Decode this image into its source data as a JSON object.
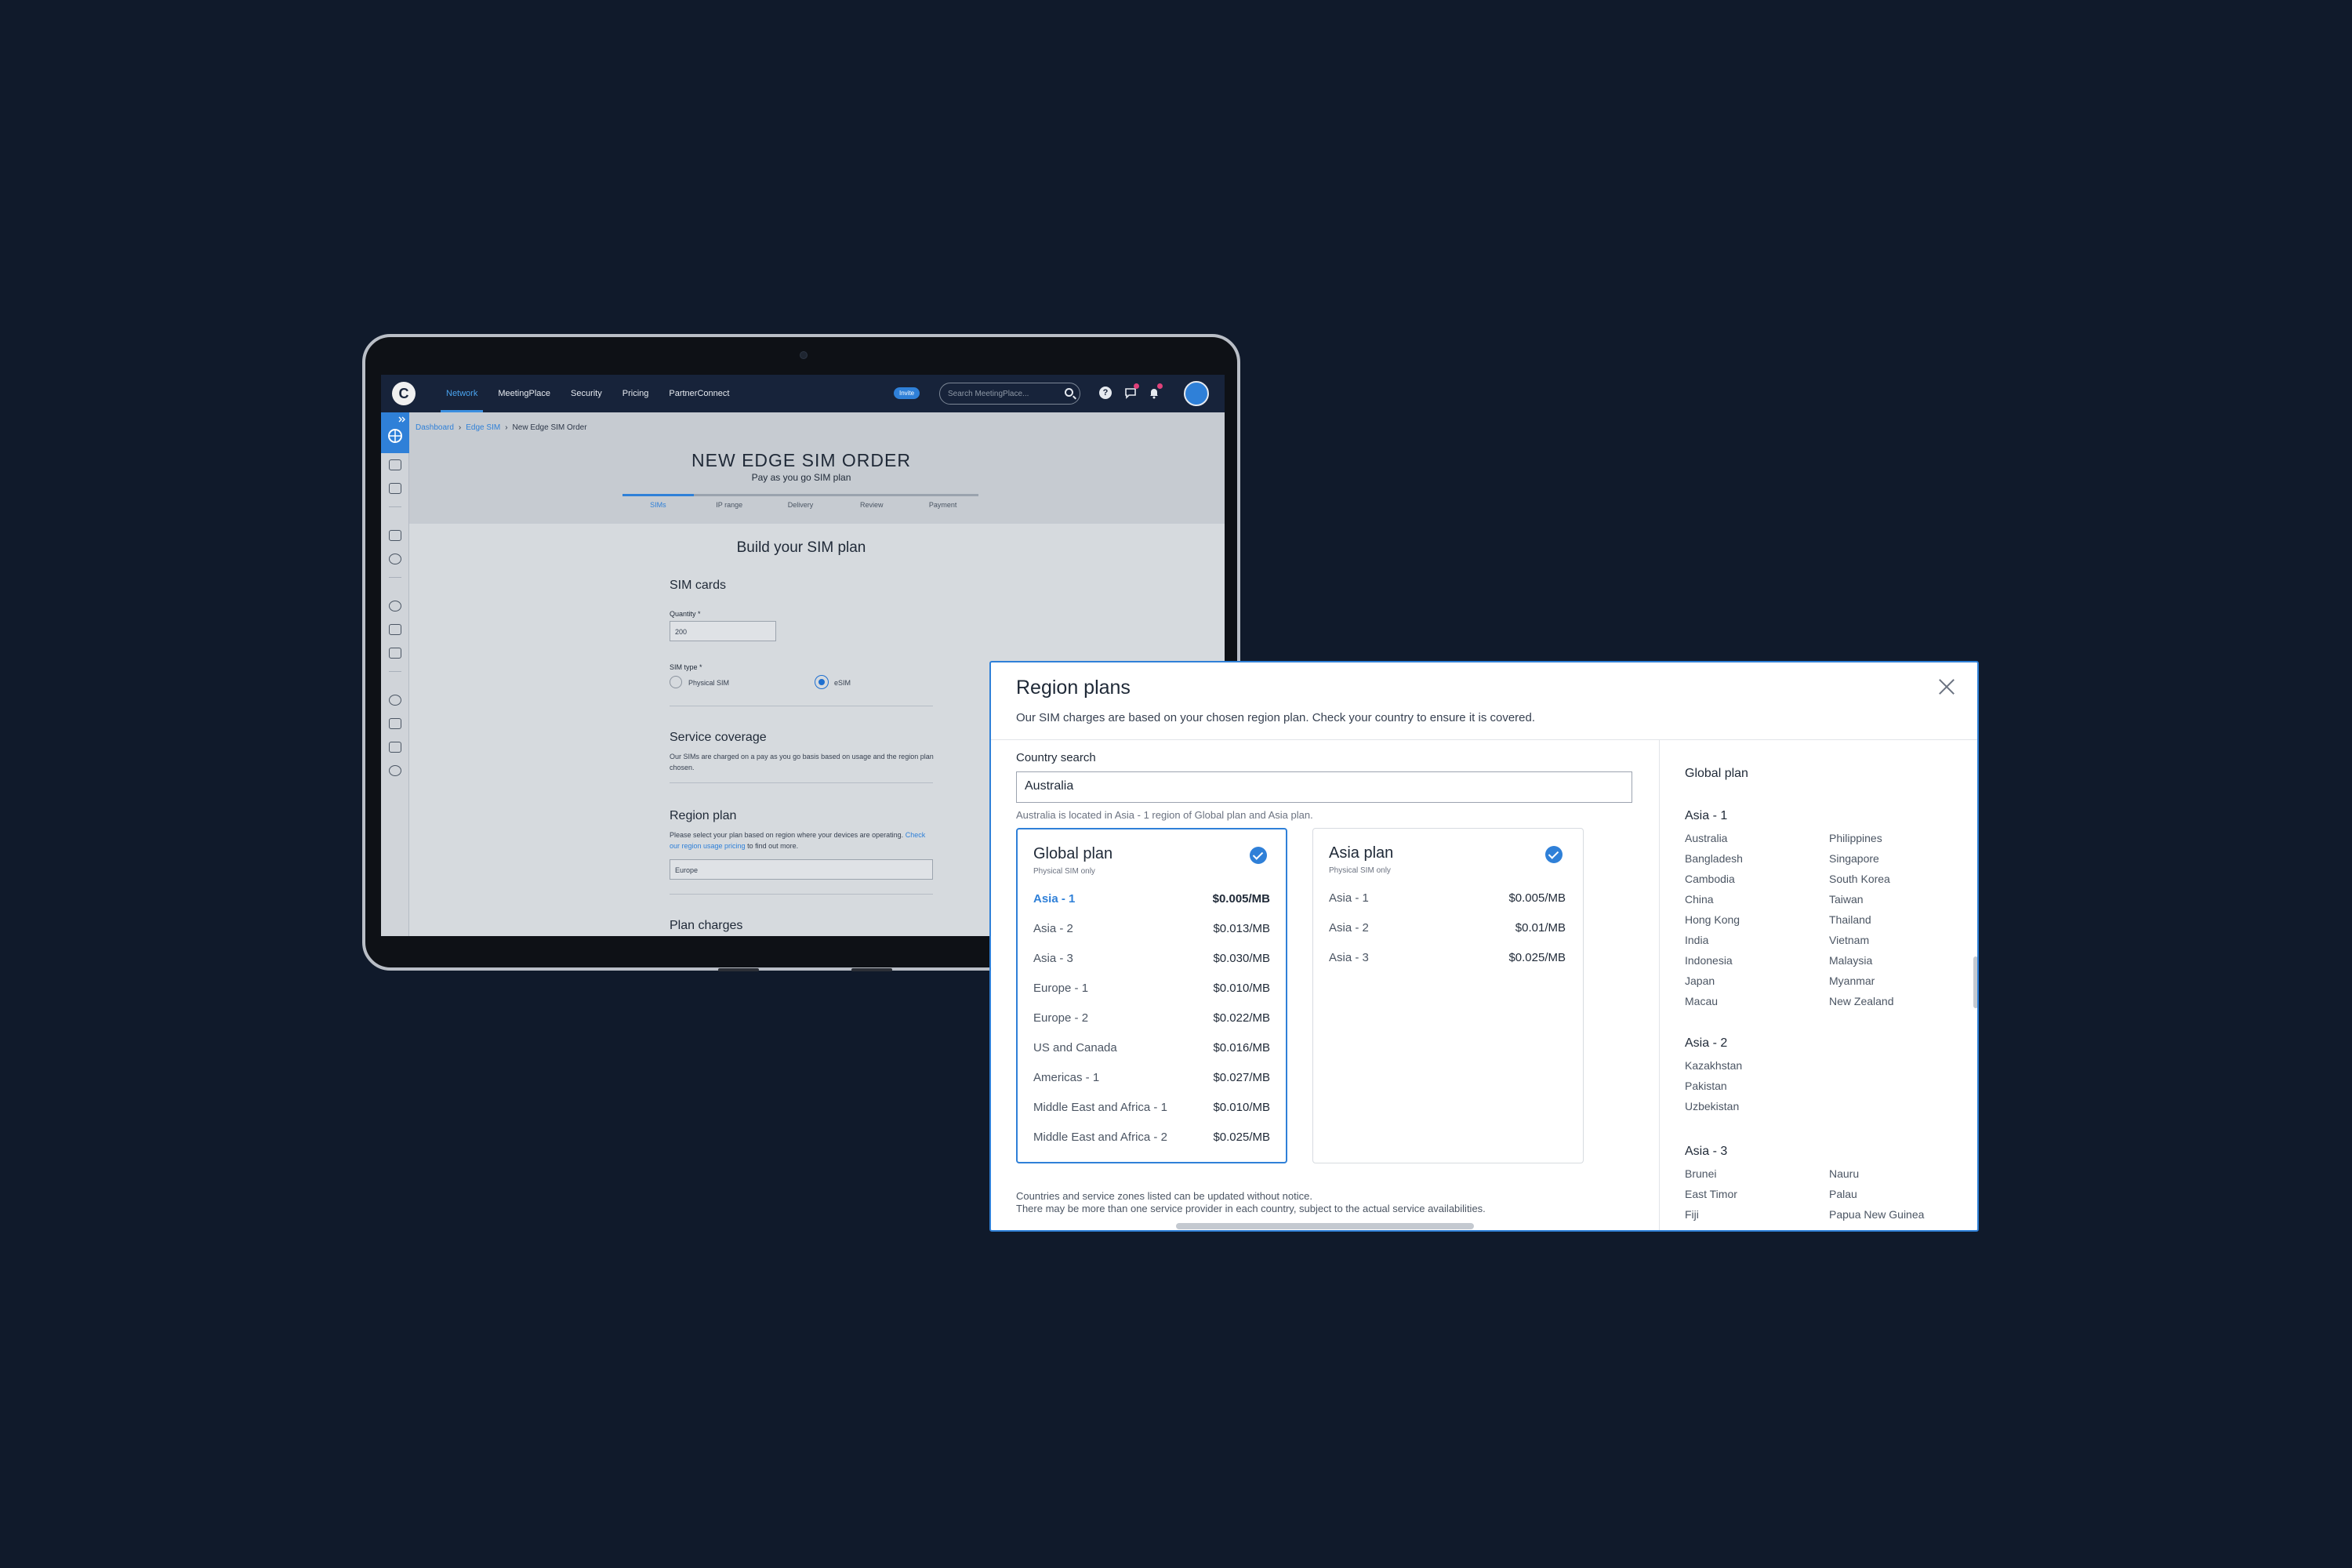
{
  "app": {
    "nav": {
      "logo_letter": "C",
      "links": [
        "Network",
        "MeetingPlace",
        "Security",
        "Pricing",
        "PartnerConnect"
      ],
      "invite": "Invite",
      "search_placeholder": "Search MeetingPlace..."
    },
    "breadcrumb": [
      "Dashboard",
      "Edge SIM",
      "New Edge SIM Order"
    ],
    "page_title": "NEW EDGE SIM ORDER",
    "page_subtitle": "Pay as you go SIM plan",
    "steps": [
      "SIMs",
      "IP range",
      "Delivery",
      "Review",
      "Payment"
    ],
    "build_title": "Build your SIM plan",
    "sim_cards": {
      "heading": "SIM cards",
      "quantity_label": "Quantity *",
      "quantity_value": "200",
      "sim_type_label": "SIM type *",
      "options": [
        "Physical SIM",
        "eSIM"
      ],
      "selected": "eSIM"
    },
    "service_coverage": {
      "heading": "Service coverage",
      "text": "Our SIMs are charged on a pay as you go basis based on usage and the region plan chosen."
    },
    "region_plan": {
      "heading": "Region plan",
      "text_before": "Please select your plan based on region where your devices are operating.",
      "link": "Check our region usage pricing",
      "text_after": "to find out more.",
      "value": "Europe"
    },
    "plan_charges_heading": "Plan charges"
  },
  "modal": {
    "title": "Region plans",
    "subtitle": "Our SIM charges are based on your chosen region plan. Check your country to ensure it is covered.",
    "country_search_label": "Country search",
    "country_search_value": "Australia",
    "country_note": "Australia is located in Asia - 1 region of Global plan and Asia plan.",
    "global_plan": {
      "name": "Global plan",
      "sub": "Physical SIM only",
      "rows": [
        {
          "name": "Asia - 1",
          "price": "$0.005/MB"
        },
        {
          "name": "Asia - 2",
          "price": "$0.013/MB"
        },
        {
          "name": "Asia - 3",
          "price": "$0.030/MB"
        },
        {
          "name": "Europe - 1",
          "price": "$0.010/MB"
        },
        {
          "name": "Europe - 2",
          "price": "$0.022/MB"
        },
        {
          "name": "US and Canada",
          "price": "$0.016/MB"
        },
        {
          "name": "Americas - 1",
          "price": "$0.027/MB"
        },
        {
          "name": "Middle East and Africa - 1",
          "price": "$0.010/MB"
        },
        {
          "name": "Middle East and Africa - 2",
          "price": "$0.025/MB"
        }
      ]
    },
    "asia_plan": {
      "name": "Asia plan",
      "sub": "Physical SIM only",
      "rows": [
        {
          "name": "Asia - 1",
          "price": "$0.005/MB"
        },
        {
          "name": "Asia - 2",
          "price": "$0.01/MB"
        },
        {
          "name": "Asia - 3",
          "price": "$0.025/MB"
        }
      ]
    },
    "footnote_1": "Countries and service zones listed can be updated without notice.",
    "footnote_2": "There may be more than one service provider in each country, subject to the actual service availabilities.",
    "right_panel": {
      "heading": "Global plan",
      "regions": [
        {
          "name": "Asia - 1",
          "col1": [
            "Australia",
            "Bangladesh",
            "Cambodia",
            "China",
            "Hong Kong",
            "India",
            "Indonesia",
            "Japan",
            "Macau"
          ],
          "col2": [
            "Philippines",
            "Singapore",
            "South Korea",
            "Taiwan",
            "Thailand",
            "Vietnam",
            "Malaysia",
            "Myanmar",
            "New Zealand"
          ]
        },
        {
          "name": "Asia - 2",
          "col1": [
            "Kazakhstan",
            "Pakistan",
            "Uzbekistan"
          ],
          "col2": []
        },
        {
          "name": "Asia - 3",
          "col1": [
            "Brunei",
            "East Timor",
            "Fiji"
          ],
          "col2": [
            "Nauru",
            "Palau",
            "Papua New Guinea"
          ]
        }
      ]
    }
  }
}
